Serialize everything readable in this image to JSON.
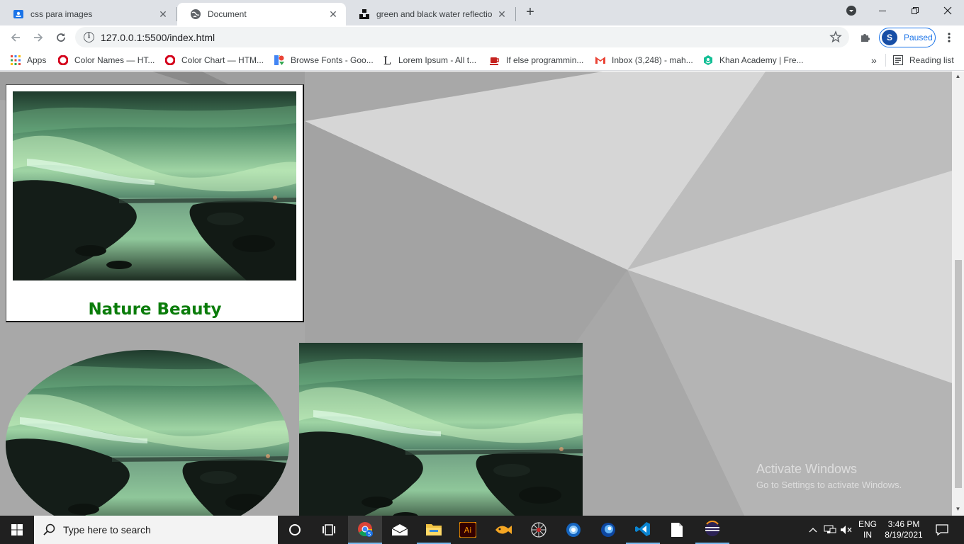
{
  "tabs": [
    {
      "title": "css para images",
      "icon": "google-classroom-icon",
      "active": false
    },
    {
      "title": "Document",
      "icon": "globe-icon",
      "active": true
    },
    {
      "title": "green and black water reflection",
      "icon": "unsplash-icon",
      "active": false
    }
  ],
  "omnibox": {
    "url": "127.0.0.1:5500/index.html"
  },
  "profile": {
    "initial": "S",
    "status": "Paused"
  },
  "bookmarks": [
    {
      "label": "Apps",
      "icon": "apps-grid-icon"
    },
    {
      "label": "Color Names — HT...",
      "icon": "opera-red-icon"
    },
    {
      "label": "Color Chart — HTM...",
      "icon": "opera-red-icon"
    },
    {
      "label": "Browse Fonts - Goo...",
      "icon": "google-fonts-icon"
    },
    {
      "label": "Lorem Ipsum - All t...",
      "icon": "lorem-l-icon"
    },
    {
      "label": "If else programmin...",
      "icon": "java-cup-icon"
    },
    {
      "label": "Inbox (3,248) - mah...",
      "icon": "gmail-icon"
    },
    {
      "label": "Khan Academy | Fre...",
      "icon": "khan-academy-icon"
    }
  ],
  "bookmarks_overflow": "»",
  "reading_list": "Reading list",
  "page": {
    "card_title": "Nature Beauty",
    "photo_alt": "green and black water reflection"
  },
  "watermark": {
    "line1": "Activate Windows",
    "line2": "Go to Settings to activate Windows."
  },
  "taskbar": {
    "search_placeholder": "Type here to search",
    "apps": [
      "cortana-icon",
      "task-view-icon",
      "chrome-icon",
      "mail-icon",
      "file-explorer-icon",
      "illustrator-icon",
      "app-fish-icon",
      "spider-app-icon",
      "circle-app-icon",
      "circle-app-2-icon",
      "vscode-icon",
      "notepad-icon",
      "eclipse-icon"
    ],
    "lang_line1": "ENG",
    "lang_line2": "IN",
    "time": "3:46 PM",
    "date": "8/19/2021"
  },
  "colors": {
    "accent": "#1a73e8",
    "title_green": "#0a7c0a",
    "page_bg": "#a9a9a9",
    "taskbar": "#202020"
  }
}
